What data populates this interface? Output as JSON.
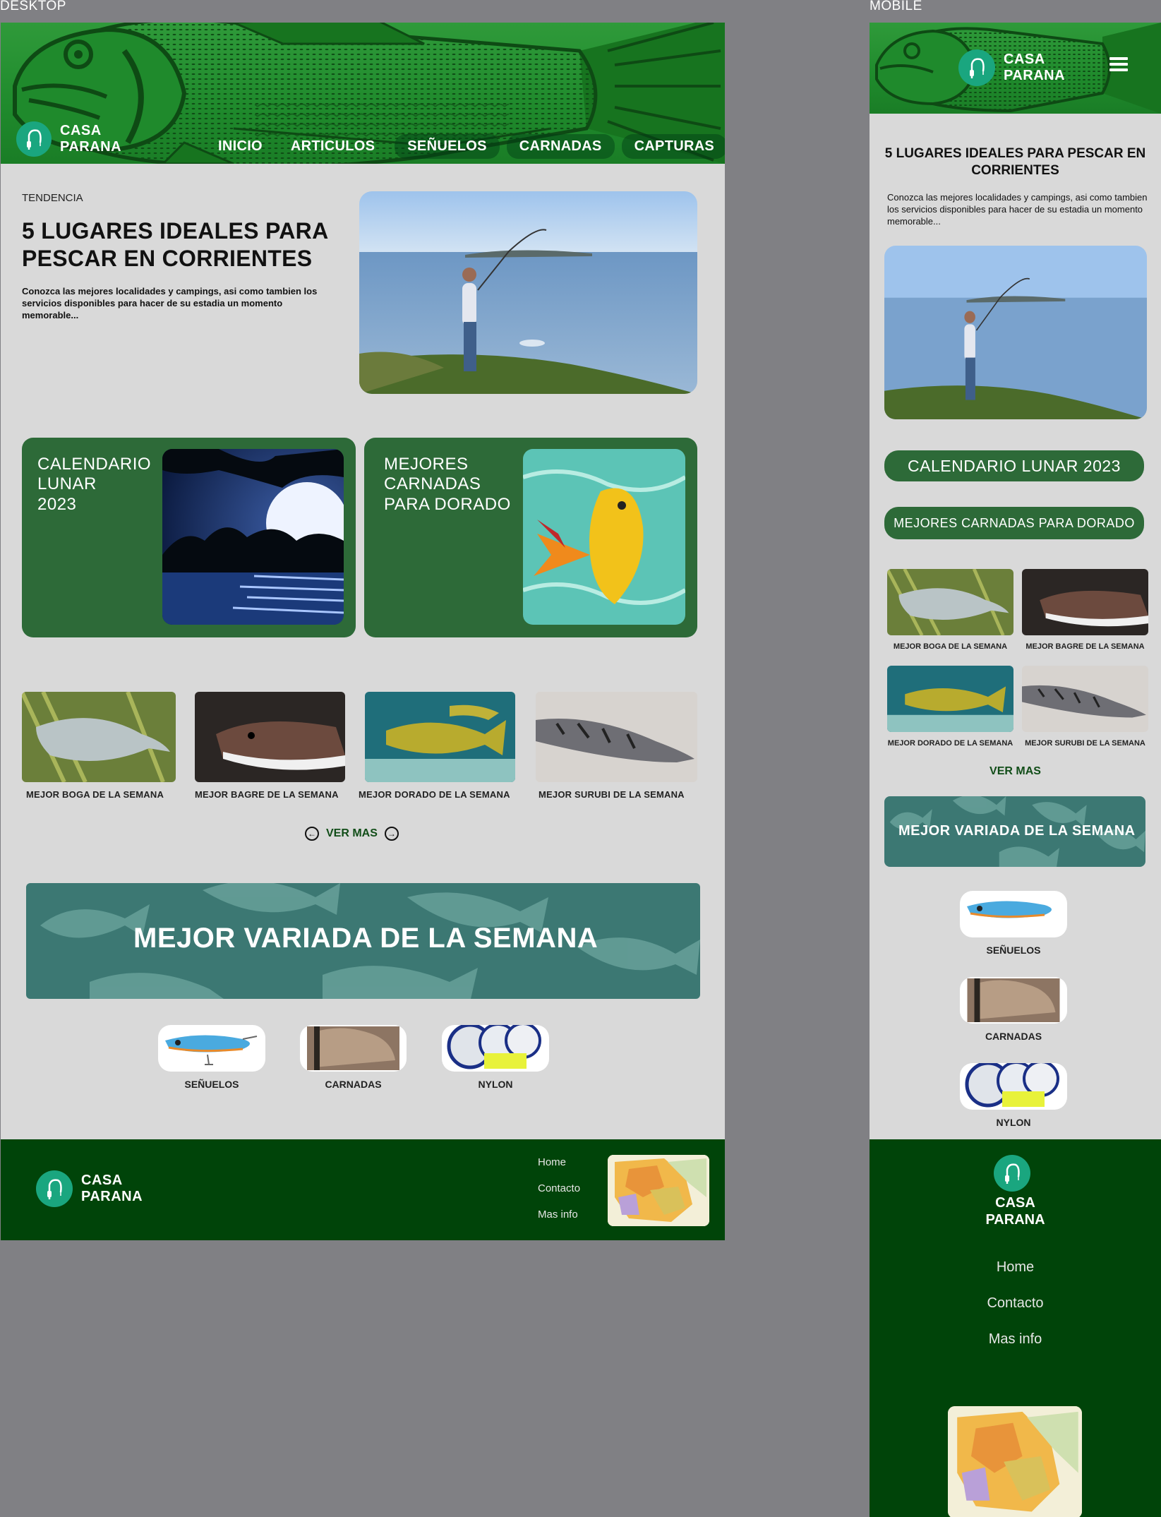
{
  "frames": {
    "desktop": "DESKTOP",
    "mobile": "MOBILE"
  },
  "brand": {
    "line1": "CASA",
    "line2": "PARANA"
  },
  "colors": {
    "brand_green": "#1aa67f",
    "dark_green": "#2d6a38",
    "footer_green": "#004409",
    "hero_green": "#1f8a2c",
    "teal_banner": "#3c7873",
    "page_bg": "#d9d9d9"
  },
  "nav": {
    "items": [
      {
        "label": "INICIO",
        "pill": false
      },
      {
        "label": "ARTICULOS",
        "pill": true
      },
      {
        "label": "SEÑUELOS",
        "pill": true
      },
      {
        "label": "CARNADAS",
        "pill": true
      },
      {
        "label": "CAPTURAS",
        "pill": true
      }
    ]
  },
  "feature": {
    "tag": "TENDENCIA",
    "title": "5 LUGARES IDEALES PARA PESCAR EN CORRIENTES",
    "summary": "Conozca las mejores localidades y campings, asi como tambien los servicios disponibles para hacer de su estadia un momento memorable..."
  },
  "cards": [
    {
      "title": "CALENDARIO LUNAR 2023",
      "lines": [
        "CALENDARIO",
        "LUNAR",
        "2023"
      ]
    },
    {
      "title": "MEJORES CARNADAS PARA DORADO",
      "lines": [
        "MEJORES",
        "CARNADAS",
        "PARA DORADO"
      ]
    }
  ],
  "best_of_week": [
    {
      "label": "MEJOR BOGA DE LA SEMANA"
    },
    {
      "label": "MEJOR BAGRE DE LA SEMANA"
    },
    {
      "label": "MEJOR DORADO DE LA SEMANA"
    },
    {
      "label": "MEJOR SURUBI DE LA SEMANA"
    }
  ],
  "ver_mas": "VER MAS",
  "banner": {
    "title": "MEJOR VARIADA DE LA SEMANA"
  },
  "products": [
    {
      "label": "SEÑUELOS"
    },
    {
      "label": "CARNADAS"
    },
    {
      "label": "NYLON"
    }
  ],
  "footer": {
    "links": [
      "Home",
      "Contacto",
      "Mas info"
    ]
  },
  "icons": {
    "brand": "fishing-rod-icon",
    "prev": "arrow-left-circle-icon",
    "next": "arrow-right-circle-icon",
    "menu": "hamburger-menu-icon"
  }
}
